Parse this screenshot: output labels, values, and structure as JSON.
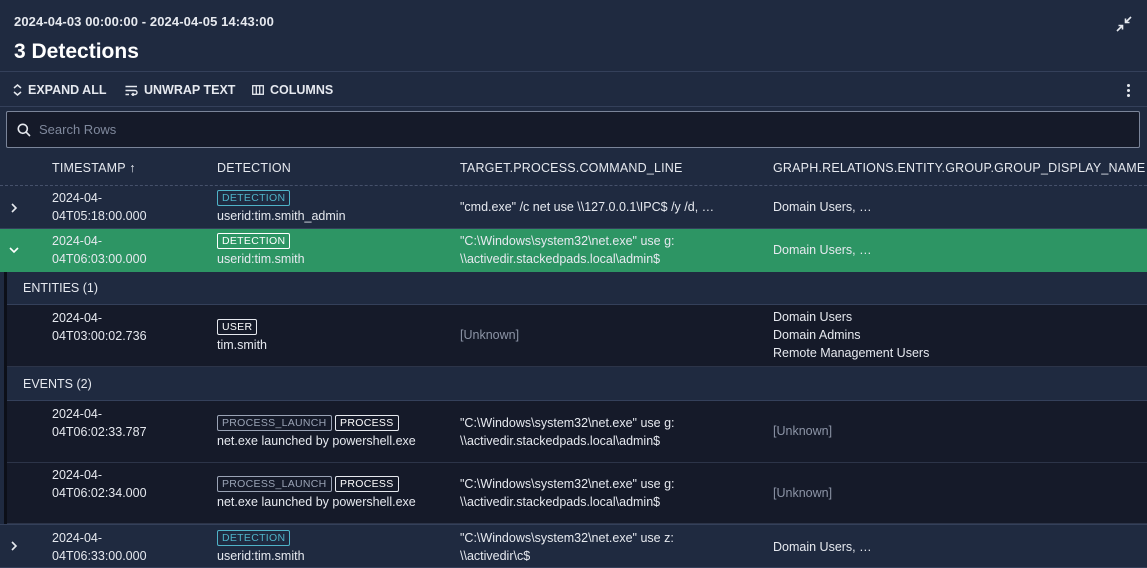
{
  "header": {
    "date_range": "2024-04-03 00:00:00 - 2024-04-05 14:43:00",
    "title": "3 Detections",
    "collapse_icon": "collapse-arrows-icon"
  },
  "toolbar": {
    "expand_all": "EXPAND ALL",
    "unwrap_text": "UNWRAP TEXT",
    "columns": "COLUMNS"
  },
  "search": {
    "placeholder": "Search Rows"
  },
  "columns": {
    "timestamp": "TIMESTAMP",
    "sort_indicator": "↑",
    "detection": "DETECTION",
    "command_line": "TARGET.PROCESS.COMMAND_LINE",
    "group": "GRAPH.RELATIONS.ENTITY.GROUP.GROUP_DISPLAY_NAME"
  },
  "rows": [
    {
      "ts1": "2024-04-",
      "ts2": "04T05:18:00.000",
      "badge": "DETECTION",
      "detection": "userid:tim.smith_admin",
      "cmd1": "\"cmd.exe\" /c net use \\\\127.0.0.1\\IPC$ /y /d, …",
      "cmd2": "",
      "group": "Domain Users, …"
    },
    {
      "ts1": "2024-04-",
      "ts2": "04T06:03:00.000",
      "badge": "DETECTION",
      "detection": "userid:tim.smith",
      "cmd1": "\"C:\\Windows\\system32\\net.exe\" use g:",
      "cmd2": "\\\\activedir.stackedpads.local\\admin$",
      "group": "Domain Users, …"
    },
    {
      "ts1": "2024-04-",
      "ts2": "04T06:33:00.000",
      "badge": "DETECTION",
      "detection": "userid:tim.smith",
      "cmd1": "\"C:\\Windows\\system32\\net.exe\" use z:",
      "cmd2": "\\\\activedir\\c$",
      "group": "Domain Users, …"
    }
  ],
  "entities": {
    "label": "ENTITIES (1)",
    "items": [
      {
        "ts1": "2024-04-",
        "ts2": "04T03:00:02.736",
        "badge": "USER",
        "name": "tim.smith",
        "cmd": "[Unknown]",
        "groups": [
          "Domain Users",
          "Domain Admins",
          "Remote Management Users"
        ]
      }
    ]
  },
  "events": {
    "label": "EVENTS (2)",
    "items": [
      {
        "ts1": "2024-04-",
        "ts2": "04T06:02:33.787",
        "badge1": "PROCESS_LAUNCH",
        "badge2": "PROCESS",
        "desc": "net.exe launched by powershell.exe",
        "cmd1": "\"C:\\Windows\\system32\\net.exe\" use g:",
        "cmd2": "\\\\activedir.stackedpads.local\\admin$",
        "group": "[Unknown]"
      },
      {
        "ts1": "2024-04-",
        "ts2": "04T06:02:34.000",
        "badge1": "PROCESS_LAUNCH",
        "badge2": "PROCESS",
        "desc": "net.exe launched by powershell.exe",
        "cmd1": "\"C:\\Windows\\system32\\net.exe\" use g:",
        "cmd2": "\\\\activedir.stackedpads.local\\admin$",
        "group": "[Unknown]"
      }
    ]
  },
  "colors": {
    "background": "#1f2a40",
    "selected_row": "#2d9564",
    "subrow": "#151a29",
    "detection_badge": "#4fb3c8"
  }
}
